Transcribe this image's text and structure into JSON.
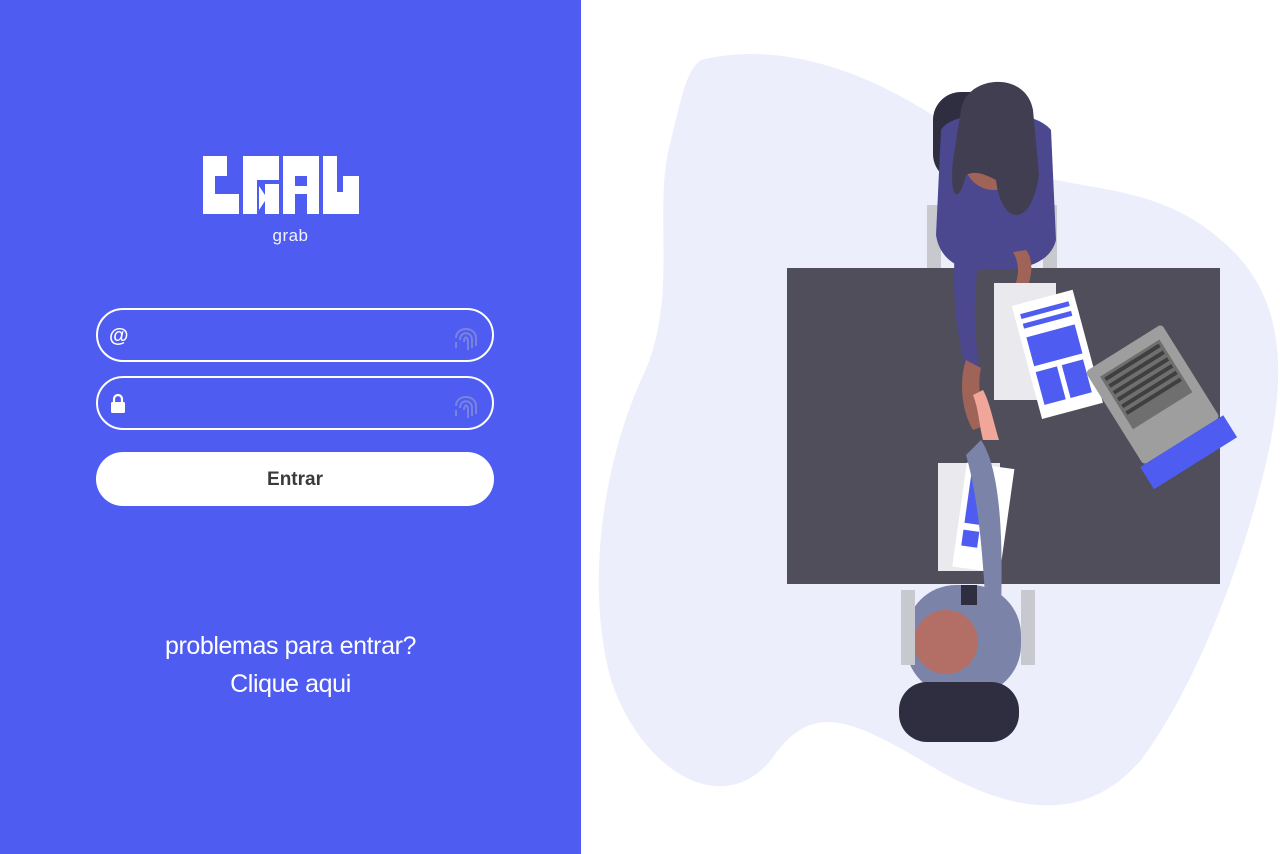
{
  "brand": {
    "name": "grab"
  },
  "login": {
    "email_icon": "at-sign-icon",
    "password_icon": "lock-icon",
    "toggle_icon": "fingerprint-icon",
    "submit_label": "Entrar"
  },
  "help": {
    "question": "problemas para entrar?",
    "link": "Clique aqui"
  },
  "colors": {
    "primary": "#4f5cf1",
    "illustration_blob": "#edeefb",
    "table": "#4f4e5a"
  }
}
